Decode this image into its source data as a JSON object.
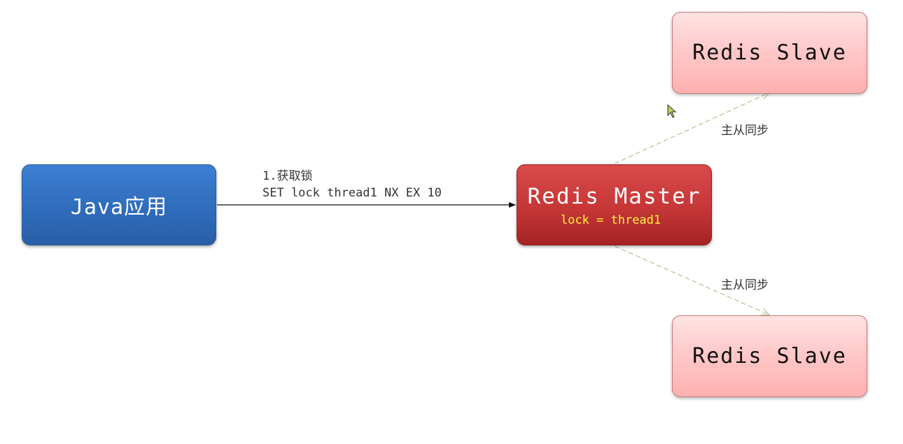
{
  "diagram": {
    "nodes": {
      "java_app": {
        "title": "Java应用"
      },
      "redis_master": {
        "title": "Redis Master",
        "sub": "lock = thread1"
      },
      "redis_slave_top": {
        "title": "Redis Slave"
      },
      "redis_slave_bottom": {
        "title": "Redis Slave"
      }
    },
    "edges": {
      "acquire_lock": {
        "step": "1.获取锁",
        "command": "SET lock thread1 NX EX 10"
      },
      "sync_top": {
        "label": "主从同步"
      },
      "sync_bottom": {
        "label": "主从同步"
      }
    }
  },
  "colors": {
    "java_app": "#2f6cbc",
    "redis_master": "#c63636",
    "redis_slave": "#ffc7c7",
    "sync_arrow": "#a8c98a",
    "lock_text": "#fff23d"
  },
  "icons": {
    "cursor": "mouse-pointer-icon"
  }
}
